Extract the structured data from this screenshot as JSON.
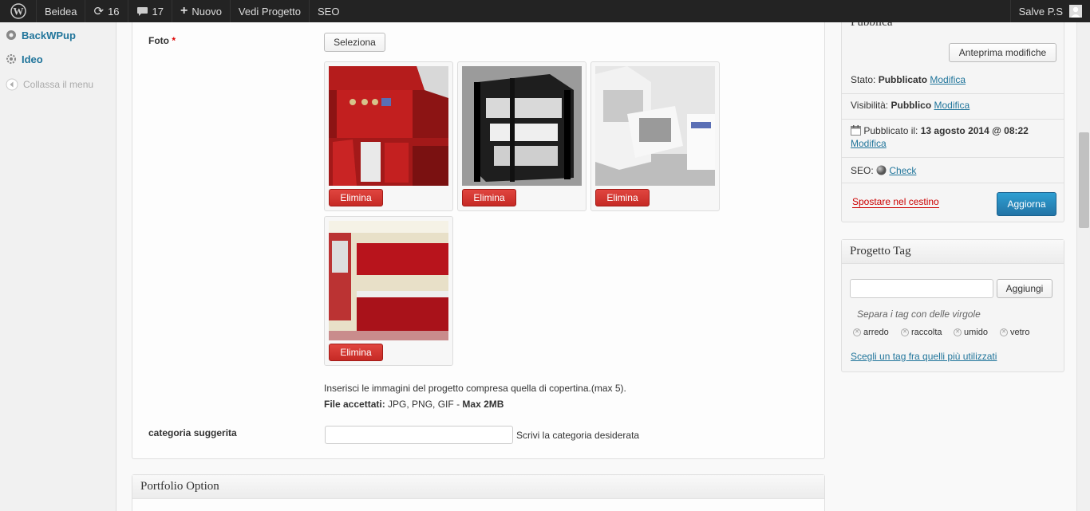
{
  "adminbar": {
    "site": "Beidea",
    "updates": "16",
    "comments": "17",
    "new": "Nuovo",
    "view": "Vedi Progetto",
    "seo": "SEO",
    "user": "Salve P.S"
  },
  "leftmenu": {
    "items": [
      {
        "label": "BackWPup"
      },
      {
        "label": "Ideo"
      }
    ],
    "collapse": "Collassa il menu"
  },
  "form": {
    "foto_label": "Foto",
    "required_mark": "*",
    "select_button": "Seleziona",
    "delete_label": "Elimina",
    "help_line1": "Inserisci le immagini del progetto compresa quella di copertina.(max 5).",
    "files_label": "File accettati:",
    "files_types": "JPG, PNG, GIF",
    "files_sep": " - ",
    "files_max": "Max 2MB",
    "category_label": "categoria suggerita",
    "category_hint": "Scrivi la categoria desiderata",
    "category_value": ""
  },
  "portfolio": {
    "title": "Portfolio Option"
  },
  "publish": {
    "title": "Pubblica",
    "preview_button": "Anteprima modifiche",
    "status_label": "Stato:",
    "status_value": "Pubblicato",
    "visibility_label": "Visibilità:",
    "visibility_value": "Pubblico",
    "published_label": "Pubblicato il:",
    "published_value": "13 agosto 2014 @ 08:22",
    "edit_link": "Modifica",
    "seo_label": "SEO:",
    "seo_link": "Check",
    "trash_link": "Spostare nel cestino",
    "update_button": "Aggiorna"
  },
  "tags": {
    "title": "Progetto Tag",
    "input_value": "",
    "add_button": "Aggiungi",
    "hint": "Separa i tag con delle virgole",
    "items": [
      "arredo",
      "raccolta",
      "umido",
      "vetro"
    ],
    "popular_link": "Scegli un tag fra quelli più utilizzati"
  },
  "colors": {
    "accent": "#21759b",
    "delete": "#d03a35",
    "update": "#2786b6"
  }
}
